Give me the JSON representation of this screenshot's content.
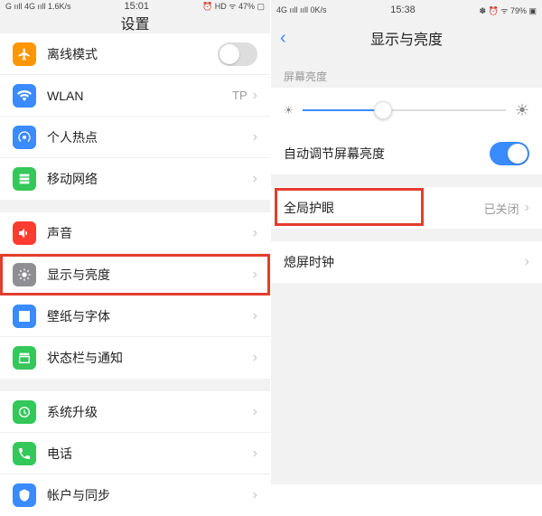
{
  "left": {
    "status": {
      "signal": "G ııll 4G ııll 1.6K/s",
      "time": "15:01",
      "right": "⏰ HD ᯤ 47% ▢"
    },
    "title": "设置",
    "groups": [
      [
        {
          "icon": "airplane",
          "color": "#ff9500",
          "label": "离线模式",
          "type": "switch",
          "on": false
        },
        {
          "icon": "wifi",
          "color": "#3a8bff",
          "label": "WLAN",
          "value": "TP"
        },
        {
          "icon": "hotspot",
          "color": "#3a8bff",
          "label": "个人热点"
        },
        {
          "icon": "mobile",
          "color": "#34c759",
          "label": "移动网络"
        }
      ],
      [
        {
          "icon": "sound",
          "color": "#ff3b30",
          "label": "声音"
        },
        {
          "icon": "brightness",
          "color": "#8e8e93",
          "label": "显示与亮度",
          "highlight": true
        },
        {
          "icon": "wallpaper",
          "color": "#3a8bff",
          "label": "壁纸与字体"
        },
        {
          "icon": "notify",
          "color": "#34c759",
          "label": "状态栏与通知"
        }
      ],
      [
        {
          "icon": "update",
          "color": "#34c759",
          "label": "系统升级"
        },
        {
          "icon": "phone",
          "color": "#34c759",
          "label": "电话"
        },
        {
          "icon": "account",
          "color": "#3a8bff",
          "label": "帐户与同步",
          "cut": true
        }
      ]
    ]
  },
  "right": {
    "status": {
      "signal": "4G ııll ııll 0K/s",
      "time": "15:38",
      "right": "✽ ⏰ ᯤ 79% ▣"
    },
    "title": "显示与亮度",
    "section_brightness": "屏幕亮度",
    "auto_brightness": "自动调节屏幕亮度",
    "eye_care": {
      "label": "全局护眼",
      "value": "已关闭"
    },
    "sleep": "熄屏时钟"
  }
}
